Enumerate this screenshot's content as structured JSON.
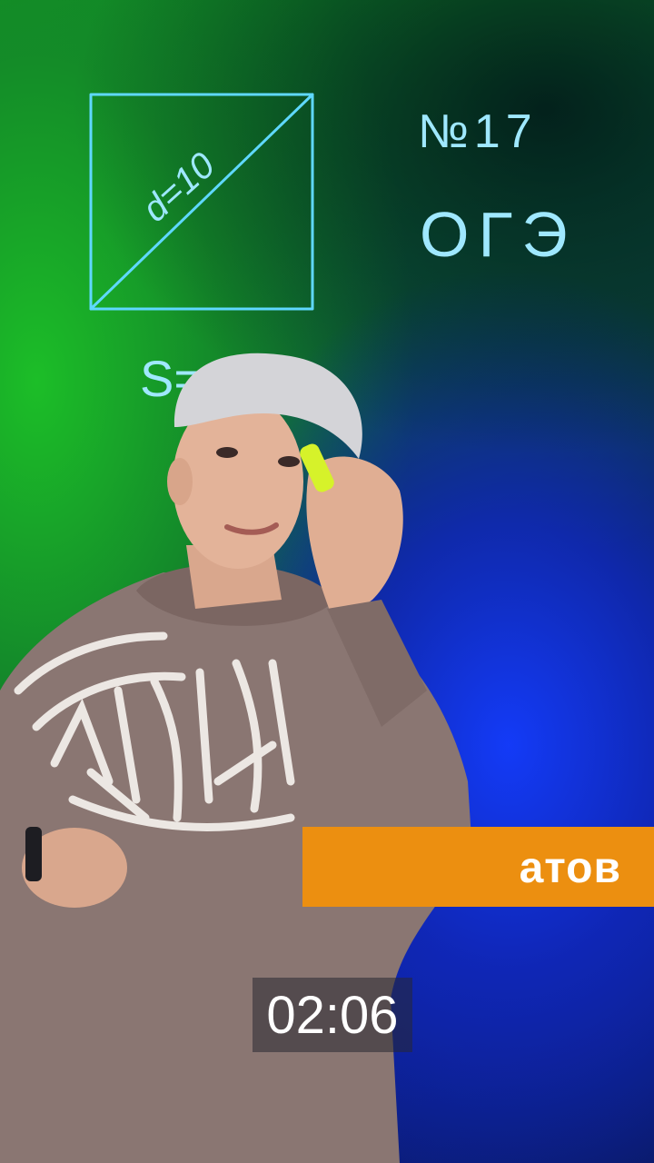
{
  "video": {
    "whiteboard": {
      "diagonal_label": "d=10",
      "problem_number": "№17",
      "exam_label": "ОГЭ",
      "question": "S=?"
    },
    "caption_banner": {
      "text": "атов",
      "color": "#ec8f10"
    },
    "timer": {
      "text": "02:06"
    },
    "colors": {
      "marker_ink": "#5fd8ff",
      "green_screen": "#15a52a",
      "blue_screen": "#1634f0",
      "hoodie": "#8a7672"
    }
  }
}
